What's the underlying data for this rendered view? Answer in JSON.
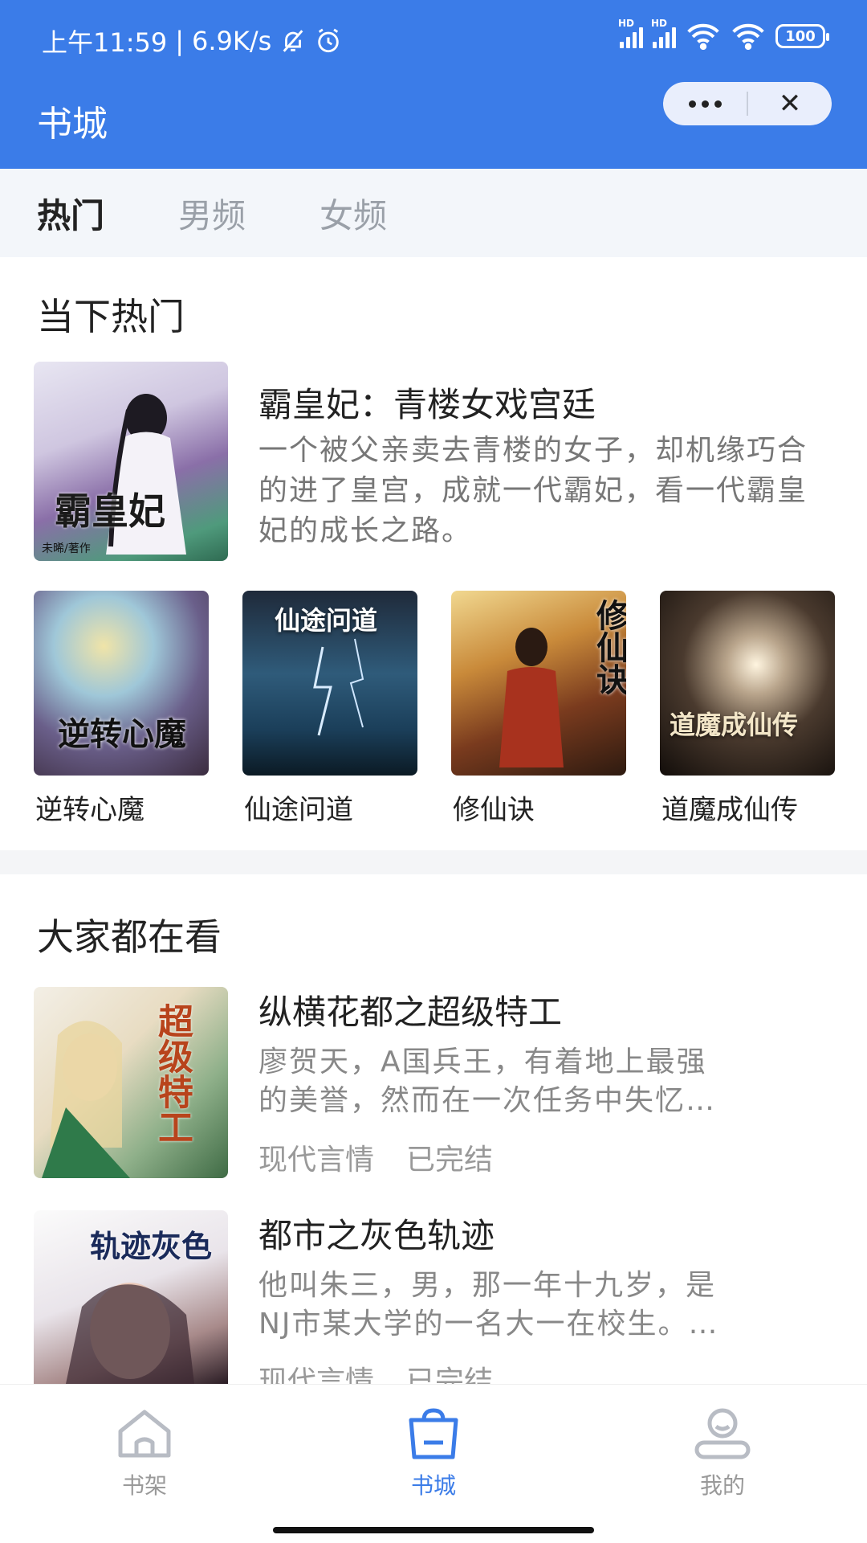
{
  "status_bar": {
    "time": "上午11:59",
    "separator": "|",
    "speed": "6.9K/s",
    "battery": "100",
    "signal_label": "HD",
    "signal_label_2": "HD"
  },
  "header": {
    "title": "书城",
    "capsule_close": "✕"
  },
  "tabs": [
    {
      "label": "热门"
    },
    {
      "label": "男频"
    },
    {
      "label": "女频"
    }
  ],
  "hot_section": {
    "title": "当下热门",
    "featured": {
      "title": "霸皇妃：青楼女戏宫廷",
      "desc": "一个被父亲卖去青楼的女子，却机缘巧合的进了皇宫，成就一代霸妃，看一代霸皇妃的成长之路。",
      "cover_text": "霸皇妃",
      "cover_sub": "未晞/著作"
    },
    "grid": [
      {
        "title": "逆转心魔",
        "cover_text": "逆转心魔"
      },
      {
        "title": "仙途问道",
        "cover_text": "仙途问道"
      },
      {
        "title": "修仙诀",
        "cover_text": "修仙诀"
      },
      {
        "title": "道魔成仙传",
        "cover_text": "道魔成仙传"
      }
    ]
  },
  "popular_section": {
    "title": "大家都在看",
    "items": [
      {
        "title": "纵横花都之超级特工",
        "desc_line1": "廖贺天，A国兵王，有着地上最强",
        "desc_line2": "的美誉，然而在一次任务中失忆…",
        "tag1": "现代言情",
        "tag2": "已完结",
        "cover_text": "超级特工"
      },
      {
        "title": "都市之灰色轨迹",
        "desc_line1": "他叫朱三，男，那一年十九岁，是",
        "desc_line2": "NJ市某大学的一名大一在校生。…",
        "tag1": "现代言情",
        "tag2": "已完结",
        "cover_text": "轨迹灰色"
      }
    ]
  },
  "bottom_nav": [
    {
      "label": "书架",
      "icon": "home-icon"
    },
    {
      "label": "书城",
      "icon": "shopping-bag-icon"
    },
    {
      "label": "我的",
      "icon": "user-icon"
    }
  ],
  "colors": {
    "primary": "#3b7ce8",
    "tabs_bg": "#f3f6fa"
  }
}
